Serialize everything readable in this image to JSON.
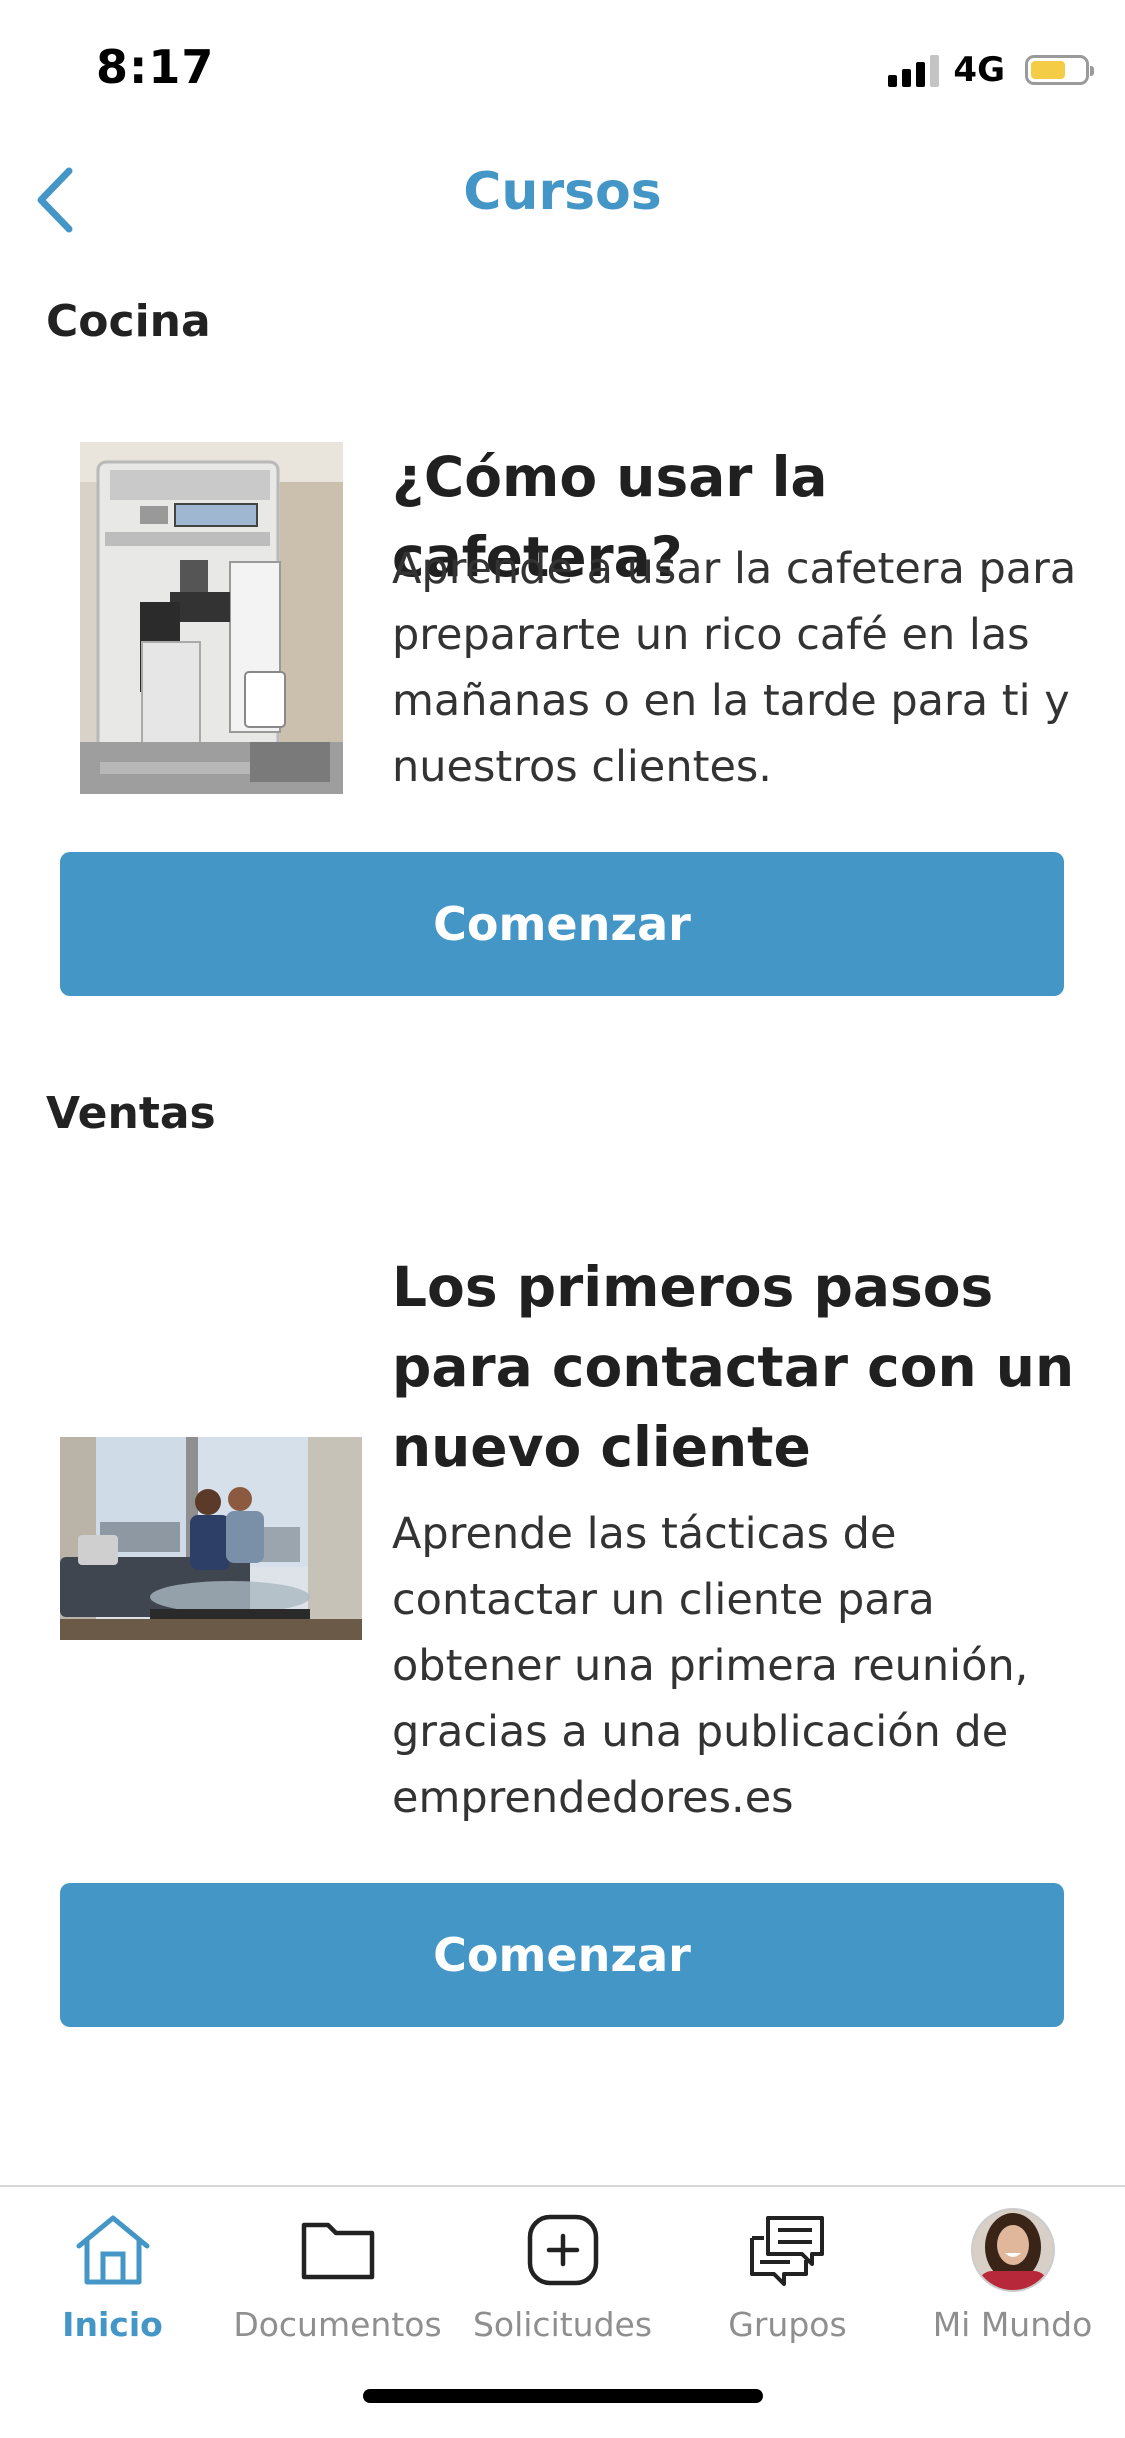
{
  "status_bar": {
    "time": "8:17",
    "network": "4G"
  },
  "nav": {
    "title": "Cursos",
    "back_icon": "chevron-left-icon"
  },
  "sections": [
    {
      "title": "Cocina",
      "course": {
        "title": "¿Cómo usar la cafetera?",
        "description": "Aprende a usar la cafetera para prepararte un rico café en las mañanas o en la tarde para ti y nuestros clientes.",
        "image": "coffee-machine-photo",
        "button": "Comenzar"
      }
    },
    {
      "title": "Ventas",
      "course": {
        "title": "Los primeros pasos para contactar con un nuevo cliente",
        "description": "Aprende las tácticas de contactar un cliente para obtener una primera reunión, gracias a una publicación de emprendedores.es",
        "image": "business-meeting-photo",
        "button": "Comenzar"
      }
    }
  ],
  "tab_bar": {
    "active": "Inicio",
    "tabs": [
      {
        "label": "Inicio",
        "icon": "home-icon"
      },
      {
        "label": "Documentos",
        "icon": "folder-icon"
      },
      {
        "label": "Solicitudes",
        "icon": "plus-square-icon"
      },
      {
        "label": "Grupos",
        "icon": "chat-bubbles-icon"
      },
      {
        "label": "Mi Mundo",
        "icon": "avatar"
      }
    ]
  },
  "colors": {
    "accent": "#4496c7",
    "battery": "#f4cc46"
  }
}
